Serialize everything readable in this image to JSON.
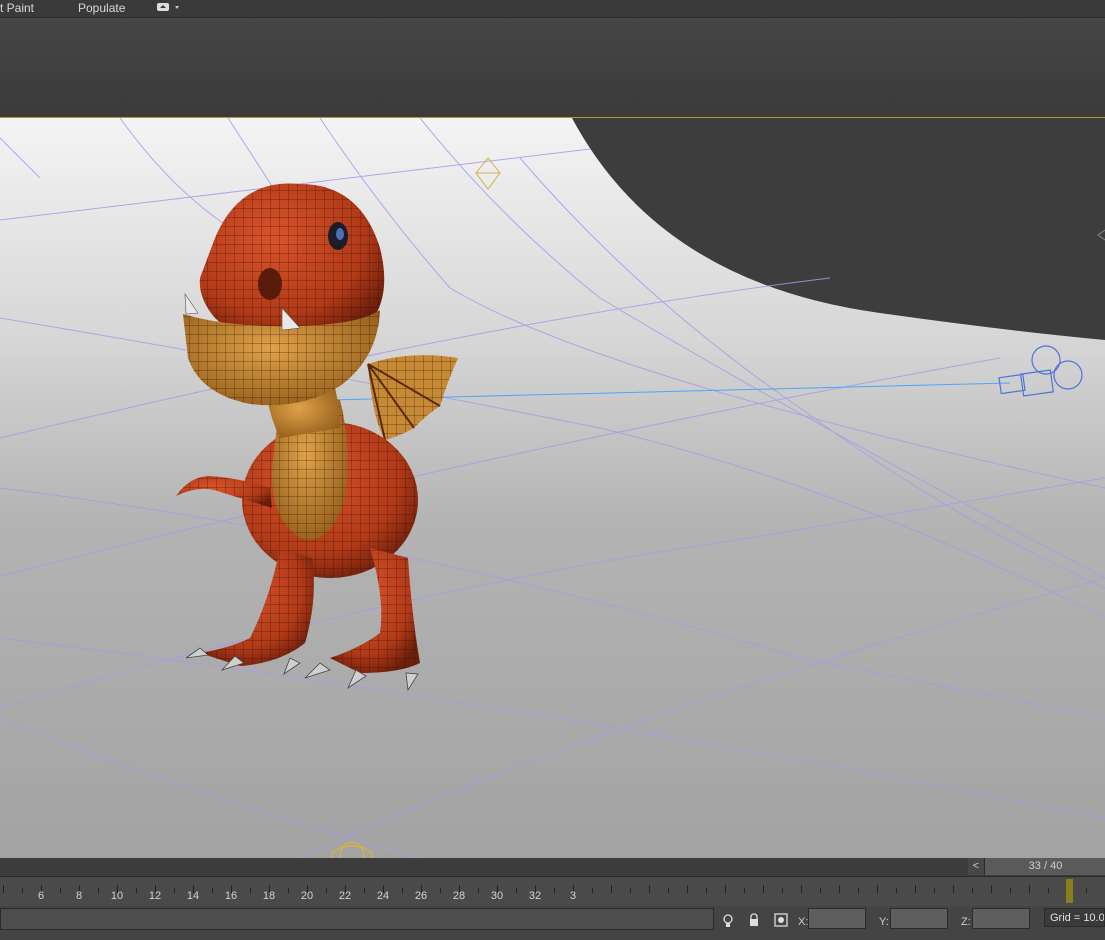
{
  "menu": {
    "items": [
      {
        "label": "t Paint"
      },
      {
        "label": "Populate"
      }
    ],
    "extra_icon": "ribbon-toggle-icon"
  },
  "viewport": {
    "scene": "3D perspective viewport",
    "colors": {
      "backdrop": "#efefef",
      "floor": "#a7a7a7",
      "grid_line": "#a99ae8",
      "frame": "#b8962e"
    },
    "objects": [
      "dragon-model",
      "camera-gizmo",
      "light-gizmo",
      "helper-point"
    ]
  },
  "timeline": {
    "frame_display": "33 / 40",
    "prev_button": "<",
    "ruler_ticks": [
      "6",
      "8",
      "10",
      "12",
      "14",
      "16",
      "18",
      "20",
      "22",
      "24",
      "26",
      "28",
      "30",
      "32",
      "3"
    ],
    "current_frame": 33
  },
  "status": {
    "x_label": "X:",
    "y_label": "Y:",
    "z_label": "Z:",
    "grid_label": "Grid = 10.0",
    "icons": [
      "lightbulb-icon",
      "lock-icon",
      "transform-type-in-icon"
    ]
  }
}
